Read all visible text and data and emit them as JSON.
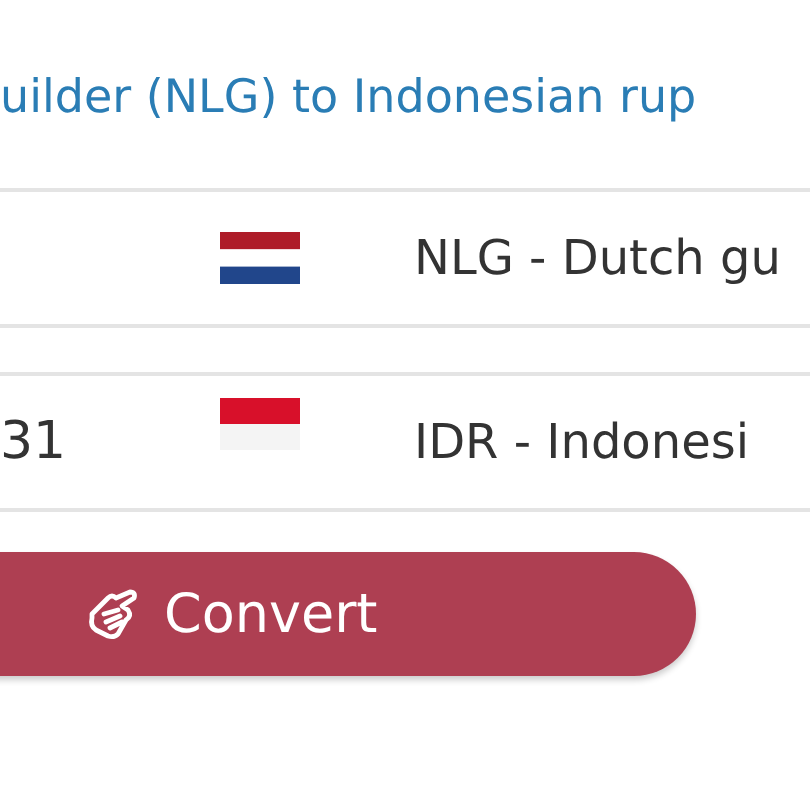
{
  "heading": "uilder (NLG) to Indonesian rup",
  "rows": [
    {
      "amount": "",
      "kind": "dutch",
      "currency": "NLG - Dutch gu"
    },
    {
      "amount": "31",
      "kind": "indonesian",
      "currency": "IDR - Indonesi"
    }
  ],
  "button": {
    "label": "Convert"
  }
}
